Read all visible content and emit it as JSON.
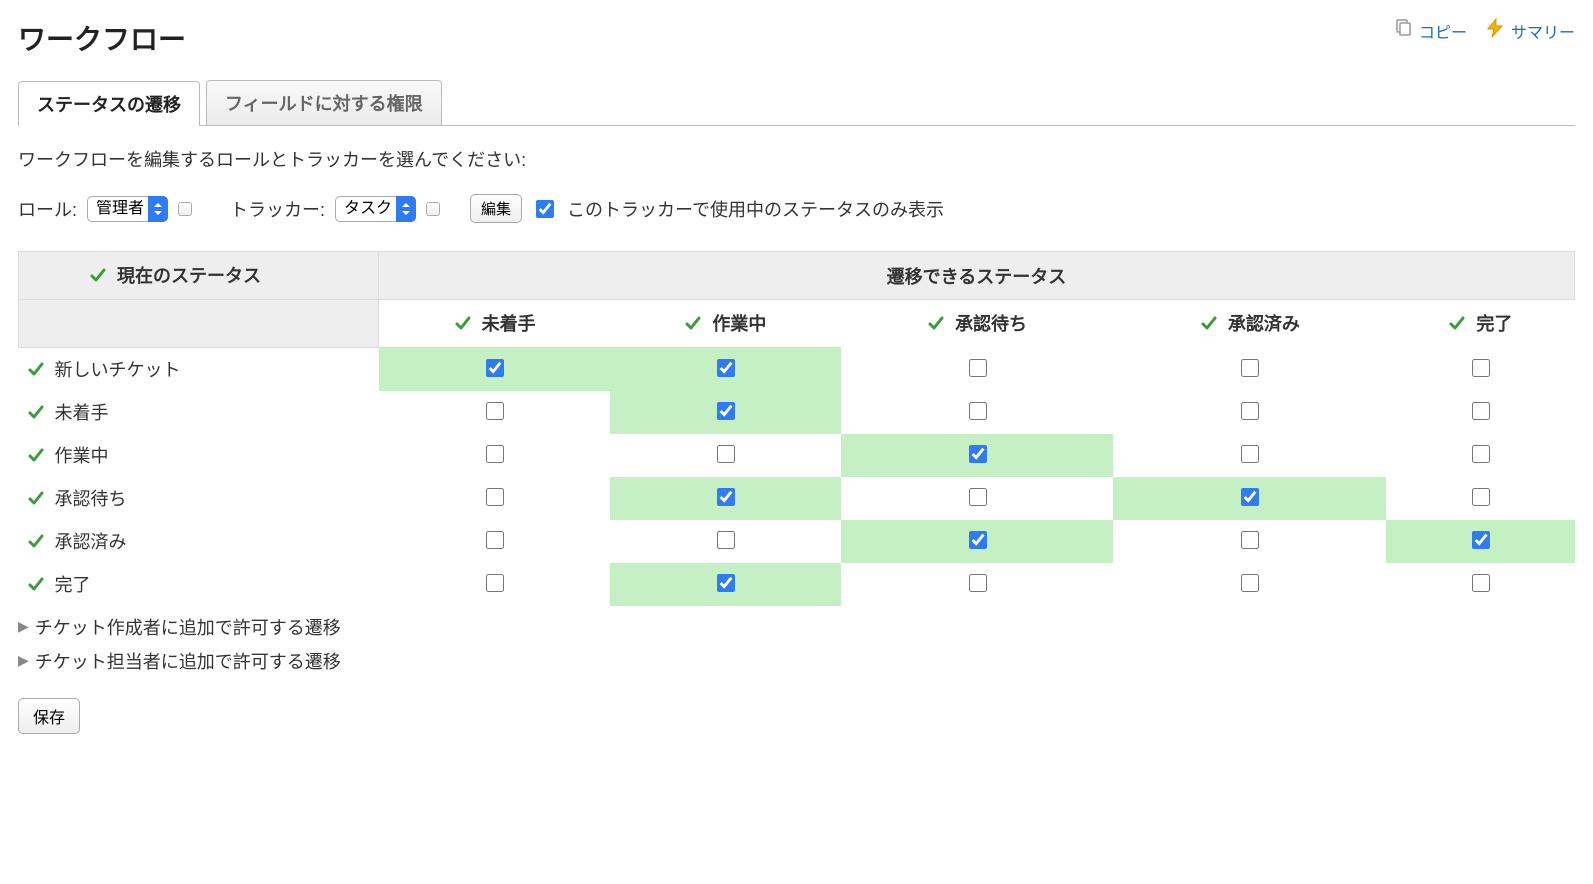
{
  "page": {
    "title": "ワークフロー"
  },
  "topLinks": {
    "copy": "コピー",
    "summary": "サマリー"
  },
  "tabs": {
    "status_transitions": "ステータスの遷移",
    "field_permissions": "フィールドに対する権限"
  },
  "instruction": "ワークフローを編集するロールとトラッカーを選んでください:",
  "filters": {
    "role_label": "ロール:",
    "role_value": "管理者",
    "tracker_label": "トラッカー:",
    "tracker_value": "タスク",
    "edit_button": "編集",
    "only_used_statuses_label": "このトラッカーで使用中のステータスのみ表示",
    "only_used_statuses_checked": true
  },
  "table": {
    "header_current": "現在のステータス",
    "header_available": "遷移できるステータス",
    "columns": [
      "未着手",
      "作業中",
      "承認待ち",
      "承認済み",
      "完了"
    ],
    "rows": [
      {
        "label": "新しいチケット",
        "cells": [
          {
            "checked": true,
            "hl": true
          },
          {
            "checked": true,
            "hl": true
          },
          {
            "checked": false,
            "hl": false
          },
          {
            "checked": false,
            "hl": false
          },
          {
            "checked": false,
            "hl": false
          }
        ]
      },
      {
        "label": "未着手",
        "cells": [
          {
            "checked": false,
            "hl": false
          },
          {
            "checked": true,
            "hl": true
          },
          {
            "checked": false,
            "hl": false
          },
          {
            "checked": false,
            "hl": false
          },
          {
            "checked": false,
            "hl": false
          }
        ]
      },
      {
        "label": "作業中",
        "cells": [
          {
            "checked": false,
            "hl": false
          },
          {
            "checked": false,
            "hl": false
          },
          {
            "checked": true,
            "hl": true
          },
          {
            "checked": false,
            "hl": false
          },
          {
            "checked": false,
            "hl": false
          }
        ]
      },
      {
        "label": "承認待ち",
        "cells": [
          {
            "checked": false,
            "hl": false
          },
          {
            "checked": true,
            "hl": true
          },
          {
            "checked": false,
            "hl": false
          },
          {
            "checked": true,
            "hl": true
          },
          {
            "checked": false,
            "hl": false
          }
        ]
      },
      {
        "label": "承認済み",
        "cells": [
          {
            "checked": false,
            "hl": false
          },
          {
            "checked": false,
            "hl": false
          },
          {
            "checked": true,
            "hl": true
          },
          {
            "checked": false,
            "hl": false
          },
          {
            "checked": true,
            "hl": true
          }
        ]
      },
      {
        "label": "完了",
        "cells": [
          {
            "checked": false,
            "hl": false
          },
          {
            "checked": true,
            "hl": true
          },
          {
            "checked": false,
            "hl": false
          },
          {
            "checked": false,
            "hl": false
          },
          {
            "checked": false,
            "hl": false
          }
        ]
      }
    ]
  },
  "expanders": {
    "author": "チケット作成者に追加で許可する遷移",
    "assignee": "チケット担当者に追加で許可する遷移"
  },
  "buttons": {
    "save": "保存"
  }
}
